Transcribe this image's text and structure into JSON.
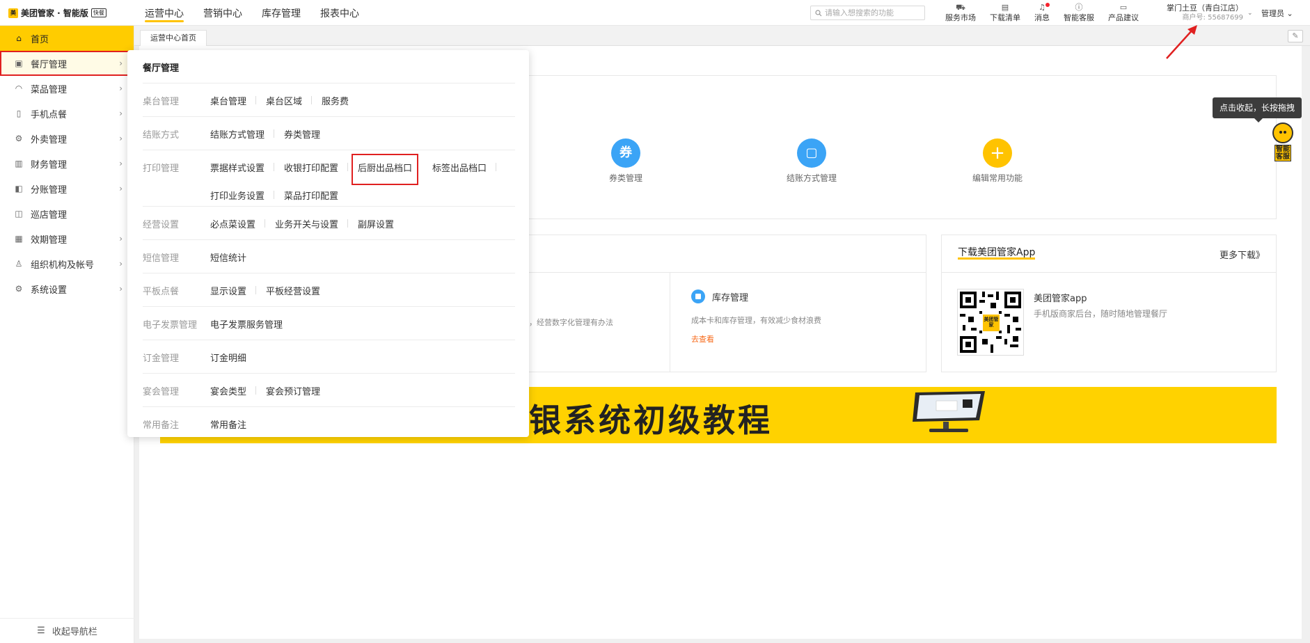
{
  "app": {
    "logo_text": "美团管家 · 智能版",
    "logo_badge": "快餐",
    "logo_mark": "美"
  },
  "topnav": [
    "运营中心",
    "营销中心",
    "库存管理",
    "报表中心"
  ],
  "search": {
    "placeholder": "请输入想搜索的功能"
  },
  "tools": [
    {
      "label": "服务市场",
      "icon": "cart-icon"
    },
    {
      "label": "下载清单",
      "icon": "clipboard-icon"
    },
    {
      "label": "消息",
      "icon": "bell-icon"
    },
    {
      "label": "智能客服",
      "icon": "help-icon"
    },
    {
      "label": "产品建议",
      "icon": "feedback-icon"
    }
  ],
  "account": {
    "store": "掌门土豆（青白江店）",
    "merchant_id": "商户号: 55687699",
    "role": "管理员"
  },
  "sidebar": {
    "items": [
      {
        "label": "首页",
        "icon": "home-icon"
      },
      {
        "label": "餐厅管理",
        "icon": "store-icon"
      },
      {
        "label": "菜品管理",
        "icon": "dish-icon"
      },
      {
        "label": "手机点餐",
        "icon": "phone-icon"
      },
      {
        "label": "外卖管理",
        "icon": "delivery-icon"
      },
      {
        "label": "财务管理",
        "icon": "wallet-icon"
      },
      {
        "label": "分账管理",
        "icon": "split-icon"
      },
      {
        "label": "巡店管理",
        "icon": "patrol-icon"
      },
      {
        "label": "效期管理",
        "icon": "calendar-icon"
      },
      {
        "label": "组织机构及帐号",
        "icon": "org-icon"
      },
      {
        "label": "系统设置",
        "icon": "settings-icon"
      }
    ],
    "collapse_label": "收起导航栏"
  },
  "tab": {
    "label": "运营中心首页"
  },
  "quick_functions": [
    {
      "label": "券类管理",
      "glyph": "券"
    },
    {
      "label": "结账方式管理",
      "glyph": "▢"
    },
    {
      "label": "编辑常用功能",
      "glyph": "+"
    }
  ],
  "mid_card": {
    "left_text": "况，经营数字化管理有办法",
    "inventory_title": "库存管理",
    "inventory_desc": "成本卡和库存管理，有效减少食材浪费",
    "inventory_link": "去查看"
  },
  "download": {
    "title": "下载美团管家App",
    "more": "更多下载》",
    "app_name": "美团管家app",
    "app_desc": "手机版商家后台，随时随地管理餐厅",
    "qr_center": "美团管家"
  },
  "banner": {
    "text": "银系统初级教程"
  },
  "panel": {
    "title": "餐厅管理",
    "rows": [
      {
        "category": "桌台管理",
        "links": [
          "桌台管理",
          "桌台区域",
          "服务费"
        ]
      },
      {
        "category": "结账方式",
        "links": [
          "结账方式管理",
          "券类管理"
        ]
      },
      {
        "category": "打印管理",
        "links": [
          "票据样式设置",
          "收银打印配置",
          "后厨出品档口",
          "标签出品档口",
          "打印业务设置",
          "菜品打印配置"
        ]
      },
      {
        "category": "经营设置",
        "links": [
          "必点菜设置",
          "业务开关与设置",
          "副屏设置"
        ]
      },
      {
        "category": "短信管理",
        "links": [
          "短信统计"
        ]
      },
      {
        "category": "平板点餐",
        "links": [
          "显示设置",
          "平板经营设置"
        ]
      },
      {
        "category": "电子发票管理",
        "links": [
          "电子发票服务管理"
        ]
      },
      {
        "category": "订金管理",
        "links": [
          "订金明细"
        ]
      },
      {
        "category": "宴会管理",
        "links": [
          "宴会类型",
          "宴会预订管理"
        ]
      },
      {
        "category": "常用备注",
        "links": [
          "常用备注"
        ]
      }
    ]
  },
  "tooltip": {
    "text": "点击收起，长按拖拽"
  },
  "helper": {
    "label": "智能客服"
  },
  "colors": {
    "brand": "#ffc300",
    "highlight": "#e02020",
    "accent_blue": "#3ba4f6",
    "link_orange": "#f76b1c"
  }
}
